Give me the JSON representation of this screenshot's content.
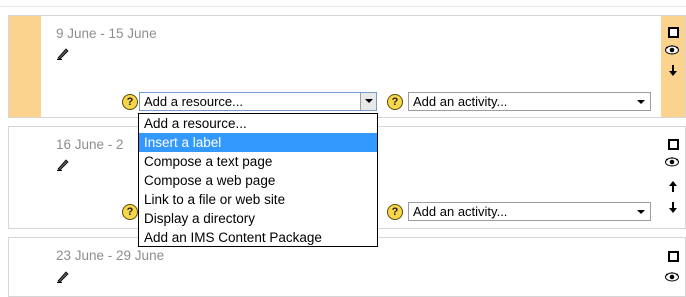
{
  "weeks": [
    {
      "title": "9 June - 15 June",
      "resource_select": "Add a resource...",
      "activity_select": "Add an activity..."
    },
    {
      "title": "16 June - 2",
      "activity_select": "Add an activity..."
    },
    {
      "title": "23 June - 29 June"
    }
  ],
  "help_symbol": "?",
  "resource_dropdown": {
    "highlighted": "Insert a label",
    "options": [
      "Add a resource...",
      "Insert a label",
      "Compose a text page",
      "Compose a web page",
      "Link to a file or web site",
      "Display a directory",
      "Add an IMS Content Package"
    ]
  },
  "colors": {
    "current_week_highlight": "#fbd38f",
    "selected_option": "#3399ff",
    "week_title": "#8e8e8e"
  },
  "icons": [
    "edit-summary-icon",
    "help-icon",
    "highlight-icon",
    "hide-icon",
    "move-down-icon",
    "move-up-icon"
  ]
}
